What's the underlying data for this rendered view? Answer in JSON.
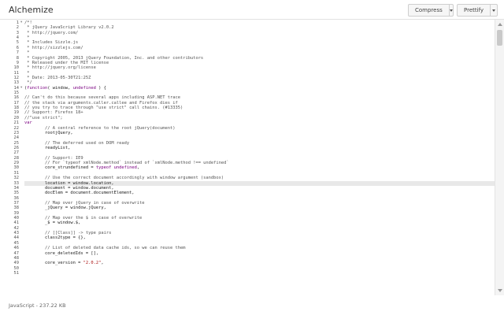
{
  "app": {
    "title": "Alchemize"
  },
  "toolbar": {
    "compress_label": "Compress",
    "prettify_label": "Prettify"
  },
  "editor": {
    "cursor_line": 33,
    "lines": [
      [
        {
          "t": "/*!",
          "c": "cm"
        }
      ],
      [
        {
          "t": " * jQuery JavaScript Library v2.0.2",
          "c": "cm"
        }
      ],
      [
        {
          "t": " * http://jquery.com/",
          "c": "cm"
        }
      ],
      [
        {
          "t": " *",
          "c": "cm"
        }
      ],
      [
        {
          "t": " * Includes Sizzle.js",
          "c": "cm"
        }
      ],
      [
        {
          "t": " * http://sizzlejs.com/",
          "c": "cm"
        }
      ],
      [
        {
          "t": " *",
          "c": "cm"
        }
      ],
      [
        {
          "t": " * Copyright 2005, 2013 jQuery Foundation, Inc. and other contributors",
          "c": "cm"
        }
      ],
      [
        {
          "t": " * Released under the MIT license",
          "c": "cm"
        }
      ],
      [
        {
          "t": " * http://jquery.org/license",
          "c": "cm"
        }
      ],
      [
        {
          "t": " *",
          "c": "cm"
        }
      ],
      [
        {
          "t": " * Date: 2013-05-30T21:25Z",
          "c": "cm"
        }
      ],
      [
        {
          "t": " */",
          "c": "cm"
        }
      ],
      [
        {
          "t": "(",
          "c": ""
        },
        {
          "t": "function",
          "c": "kw"
        },
        {
          "t": "( window, ",
          "c": ""
        },
        {
          "t": "undefined",
          "c": "kw"
        },
        {
          "t": " ) {",
          "c": ""
        }
      ],
      [],
      [
        {
          "t": "// Can't do this because several apps including ASP.NET trace",
          "c": "cm"
        }
      ],
      [
        {
          "t": "// the stack via arguments.caller.callee and Firefox dies if",
          "c": "cm"
        }
      ],
      [
        {
          "t": "// you try to trace through \"use strict\" call chains. (#13335)",
          "c": "cm"
        }
      ],
      [
        {
          "t": "// Support: Firefox 18+",
          "c": "cm"
        }
      ],
      [
        {
          "t": "//\"use strict\";",
          "c": "cm"
        }
      ],
      [
        {
          "t": "var",
          "c": "kw"
        }
      ],
      [
        {
          "t": "        // A central reference to the root jQuery(document)",
          "c": "cm"
        }
      ],
      [
        {
          "t": "        rootjQuery,",
          "c": ""
        }
      ],
      [],
      [
        {
          "t": "        // The deferred used on DOM ready",
          "c": "cm"
        }
      ],
      [
        {
          "t": "        readyList,",
          "c": ""
        }
      ],
      [],
      [
        {
          "t": "        // Support: IE9",
          "c": "cm"
        }
      ],
      [
        {
          "t": "        // For `typeof xmlNode.method` instead of `xmlNode.method !== undefined`",
          "c": "cm"
        }
      ],
      [
        {
          "t": "        core_strundefined = ",
          "c": ""
        },
        {
          "t": "typeof",
          "c": "kw"
        },
        {
          "t": " ",
          "c": ""
        },
        {
          "t": "undefined",
          "c": "kw"
        },
        {
          "t": ",",
          "c": ""
        }
      ],
      [],
      [
        {
          "t": "        // Use the correct document accordingly with window argument (sandbox)",
          "c": "cm"
        }
      ],
      [
        {
          "t": "        location = window.location,",
          "c": ""
        }
      ],
      [
        {
          "t": "        document = window.document,",
          "c": ""
        }
      ],
      [
        {
          "t": "        docElem = document.documentElement,",
          "c": ""
        }
      ],
      [],
      [
        {
          "t": "        // Map over jQuery in case of overwrite",
          "c": "cm"
        }
      ],
      [
        {
          "t": "        _jQuery = window.jQuery,",
          "c": ""
        }
      ],
      [],
      [
        {
          "t": "        // Map over the $ in case of overwrite",
          "c": "cm"
        }
      ],
      [
        {
          "t": "        _$ = window.$,",
          "c": ""
        }
      ],
      [],
      [
        {
          "t": "        // [[Class]] -> type pairs",
          "c": "cm"
        }
      ],
      [
        {
          "t": "        class2type = {},",
          "c": ""
        }
      ],
      [],
      [
        {
          "t": "        // List of deleted data cache ids, so we can reuse them",
          "c": "cm"
        }
      ],
      [
        {
          "t": "        core_deletedIds = [],",
          "c": ""
        }
      ],
      [],
      [
        {
          "t": "        core_version = ",
          "c": ""
        },
        {
          "t": "\"2.0.2\"",
          "c": "str"
        },
        {
          "t": ",",
          "c": ""
        }
      ],
      [],
      []
    ]
  },
  "status": {
    "text": "JavaScript - 237.22 KB"
  }
}
